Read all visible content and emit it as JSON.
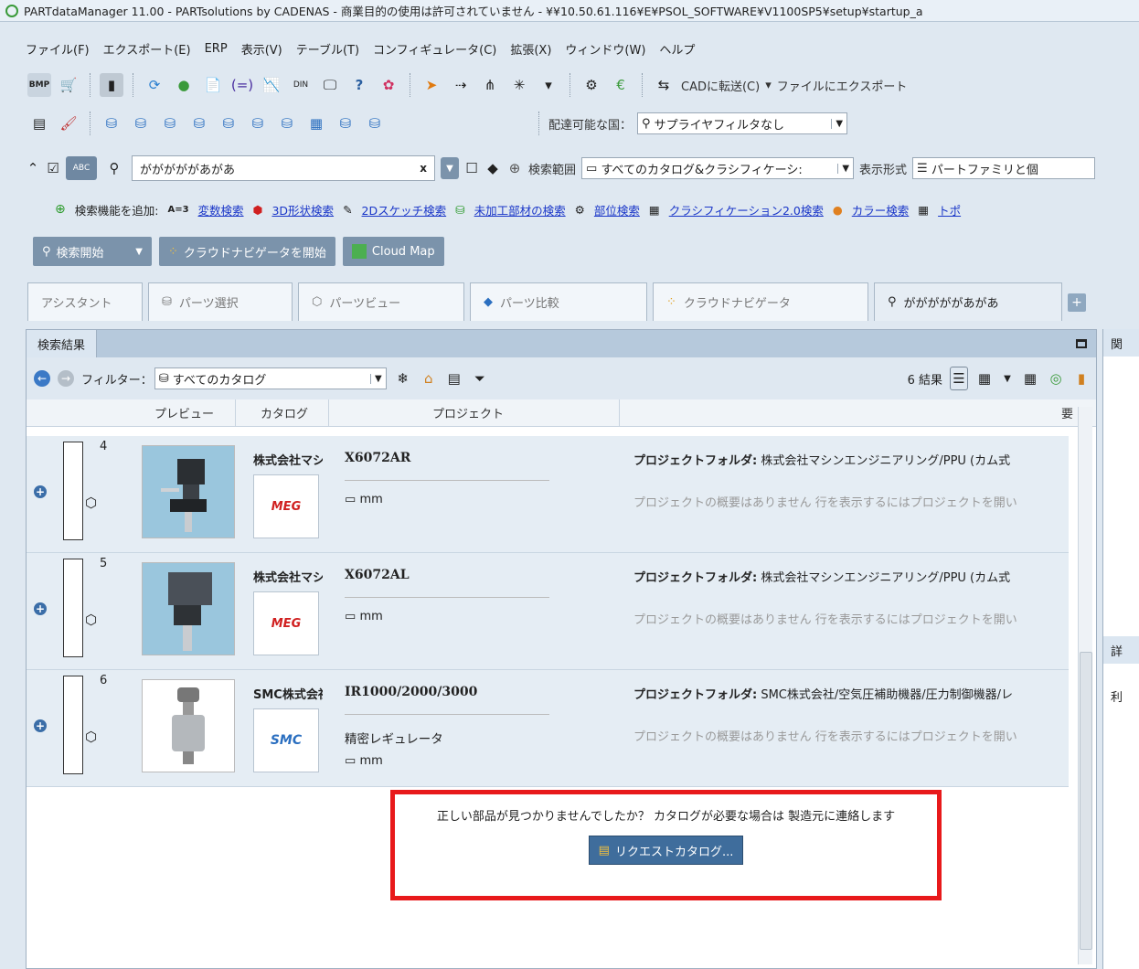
{
  "title": "PARTdataManager 11.00 - PARTsolutions by CADENAS - 商業目的の使用は許可されていません - ¥¥10.50.61.116¥E¥PSOL_SOFTWARE¥V1100SP5¥setup¥startup_a",
  "menu": [
    "ファイル(F)",
    "エクスポート(E)",
    "ERP",
    "表示(V)",
    "テーブル(T)",
    "コンフィギュレータ(C)",
    "拡張(X)",
    "ウィンドウ(W)",
    "ヘルプ"
  ],
  "toolbar1": {
    "cad_transfer": "CADに転送(C)",
    "file_export": "ファイルにエクスポート"
  },
  "toolbar2": {
    "country_label": "配達可能な国：",
    "supplier_filter": "サプライヤフィルタなし"
  },
  "search": {
    "query": "がががががあがあ",
    "scope_label": "検索範囲",
    "scope_value": "すべてのカタログ&クラシフィケーシ:",
    "display_label": "表示形式",
    "display_value": "パートファミリと個"
  },
  "add_search": {
    "label": "検索機能を追加:",
    "links": [
      "変数検索",
      "3D形状検索",
      "2Dスケッチ検索",
      "未加工部材の検索",
      "部位検索",
      "クラシフィケーション2.0検索",
      "カラー検索",
      "トポ"
    ]
  },
  "buttons": {
    "search_start": "検索開始",
    "cloud_nav_start": "クラウドナビゲータを開始",
    "cloud_map": "Cloud Map"
  },
  "tabs": [
    "アシスタント",
    "パーツ選択",
    "パーツビュー",
    "パーツ比較",
    "クラウドナビゲータ",
    "がががががあがあ"
  ],
  "results_panel": {
    "tab": "検索結果",
    "filter_label": "フィルター：",
    "filter_value": "すべてのカタログ",
    "results_count": "6 結果",
    "columns": [
      "プレビュー",
      "カタログ",
      "プロジェクト",
      "要"
    ]
  },
  "rows": [
    {
      "index": "4",
      "vendor": "株式会社マシンエンジニアリング",
      "logo": "MEG",
      "project": "X6072AR",
      "subname": "",
      "unit": "mm",
      "folder_label": "プロジェクトフォルダ:",
      "folder_path": "株式会社マシンエンジニアリング/PPU (カム式",
      "overview": "プロジェクトの概要はありません 行を表示するにはプロジェクトを開い"
    },
    {
      "index": "5",
      "vendor": "株式会社マシンエンジニアリング",
      "logo": "MEG",
      "project": "X6072AL",
      "subname": "",
      "unit": "mm",
      "folder_label": "プロジェクトフォルダ:",
      "folder_path": "株式会社マシンエンジニアリング/PPU (カム式",
      "overview": "プロジェクトの概要はありません 行を表示するにはプロジェクトを開い"
    },
    {
      "index": "6",
      "vendor": "SMC株式会社",
      "logo": "SMC",
      "project": "IR1000/2000/3000",
      "subname": "精密レギュレータ",
      "unit": "mm",
      "folder_label": "プロジェクトフォルダ:",
      "folder_path": "SMC株式会社/空気圧補助機器/圧力制御機器/レ",
      "overview": "プロジェクトの概要はありません 行を表示するにはプロジェクトを開い"
    }
  ],
  "not_found": {
    "message": "正しい部品が見つかりませんでしたか？ カタログが必要な場合は 製造元に連絡します",
    "request_button": "リクエストカタログ..."
  },
  "right_panel": {
    "label1": "関",
    "label2": "詳",
    "label3": "利"
  },
  "colors": {
    "highlight_border": "#e8191b",
    "link": "#1a36c8",
    "accent_button": "#3f6d9c"
  }
}
